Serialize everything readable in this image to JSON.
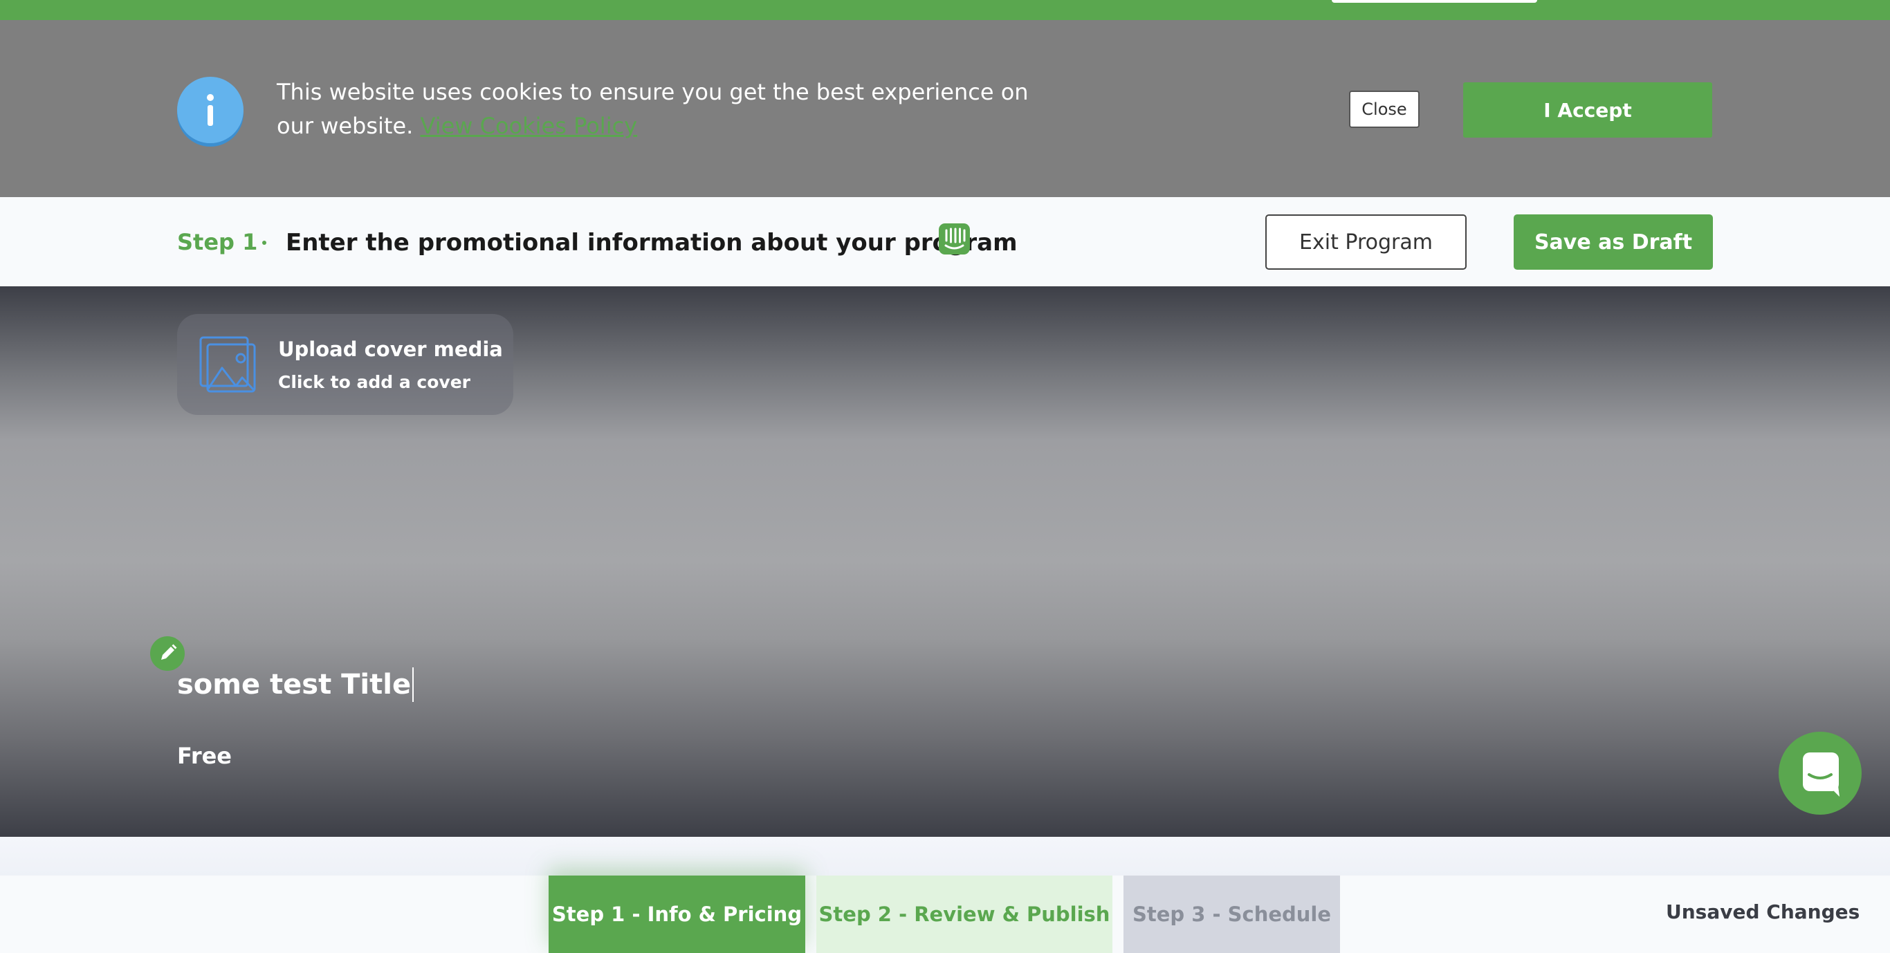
{
  "cookie_banner": {
    "message": "This website uses cookies to ensure you get the best experience on our website.",
    "policy_link": "View Cookies Policy",
    "close_label": "Close",
    "accept_label": "I Accept"
  },
  "step_header": {
    "step_label": "Step 1",
    "description": "Enter the promotional information about your program",
    "exit_label": "Exit Program",
    "draft_label": "Save as Draft"
  },
  "cover": {
    "upload_title": "Upload cover media",
    "upload_subtitle": "Click to add a cover",
    "program_title": "some test Title",
    "price": "Free"
  },
  "footer": {
    "tabs": [
      {
        "label": "Step 1 - Info & Pricing"
      },
      {
        "label": "Step 2 - Review & Publish"
      },
      {
        "label": "Step 3 - Schedule"
      }
    ],
    "status": "Unsaved Changes"
  },
  "colors": {
    "brand_green": "#5aa74f",
    "info_blue": "#63b3ed",
    "cookie_bg": "#7f7f7f"
  },
  "icons": [
    "info-icon",
    "intercom-icon",
    "image-upload-icon",
    "pencil-icon",
    "chat-icon"
  ]
}
